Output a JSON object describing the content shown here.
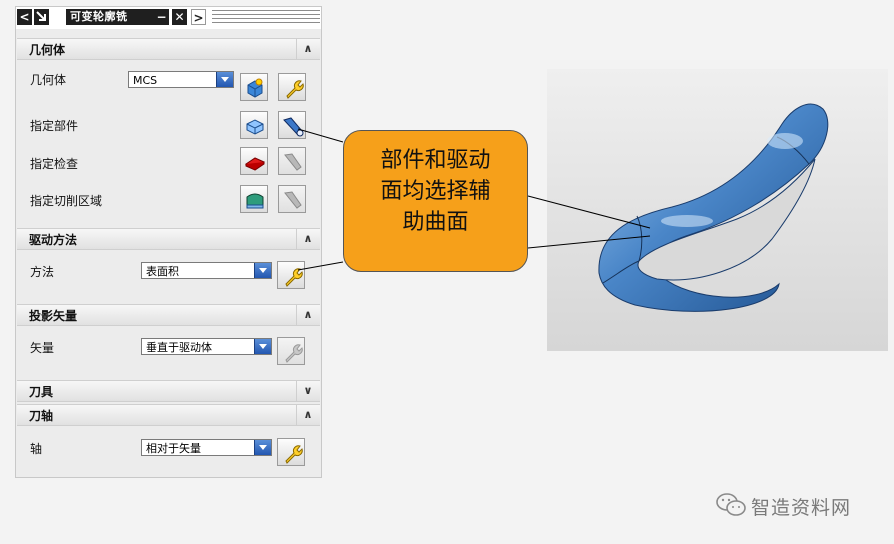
{
  "dialog": {
    "title": "可变轮廓铣",
    "titlebar_buttons": {
      "back": "<",
      "minimize": "−",
      "close": "✕",
      "forward": ">"
    },
    "sections": {
      "geometry": {
        "header": "几何体",
        "geometry_label": "几何体",
        "geometry_value": "MCS",
        "part_label": "指定部件",
        "check_label": "指定检查",
        "cut_area_label": "指定切削区域"
      },
      "drive_method": {
        "header": "驱动方法",
        "method_label": "方法",
        "method_value": "表面积"
      },
      "projection_vector": {
        "header": "投影矢量",
        "vector_label": "矢量",
        "vector_value": "垂直于驱动体"
      },
      "tool": {
        "header": "刀具"
      },
      "tool_axis": {
        "header": "刀轴",
        "axis_label": "轴",
        "axis_value": "相对于矢量"
      }
    },
    "chevrons": {
      "up": "∧",
      "down": "∨"
    }
  },
  "callout": {
    "line1": "部件和驱动",
    "line2": "面均选择辅",
    "line3": "助曲面"
  },
  "watermark": {
    "text": "智造资料网"
  },
  "colors": {
    "callout_fill": "#f6a01a",
    "model_surface": "#4a86c8",
    "dropdown_arrow": "#2256b0"
  }
}
